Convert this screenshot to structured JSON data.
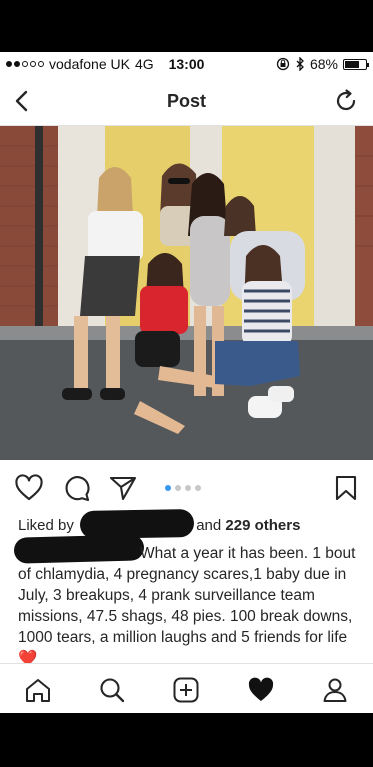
{
  "status_bar": {
    "signal_dots_filled": 2,
    "signal_dots_total": 5,
    "carrier": "vodafone UK",
    "network": "4G",
    "time": "13:00",
    "battery_percent": "68%",
    "battery_level": 0.68
  },
  "nav": {
    "title": "Post",
    "back_icon": "chevron-left-icon",
    "refresh_icon": "refresh-icon"
  },
  "post": {
    "pager_total": 4,
    "pager_active": 1,
    "likes": {
      "prefix": "Liked by",
      "suffix": "and",
      "others": "229 others"
    },
    "caption": "What a year it has been. 1 bout of chlamydia, 4 pregnancy scares,1 baby due in July, 3 breakups, 4 prank surveillance team missions, 47.5 shags, 48 pies. 100 break downs, 1000 tears, a million laughs and 5 friends for life",
    "caption_emoji": "❤️"
  },
  "action_icons": [
    "heart-outline-icon",
    "comment-icon",
    "share-icon",
    "bookmark-icon"
  ],
  "tabbar_icons": [
    "home-icon",
    "search-icon",
    "add-post-icon",
    "activity-heart-icon",
    "profile-icon"
  ],
  "colors": {
    "accent_blue": "#3897f0",
    "text": "#262626",
    "emoji_heart": "#e0242f"
  }
}
